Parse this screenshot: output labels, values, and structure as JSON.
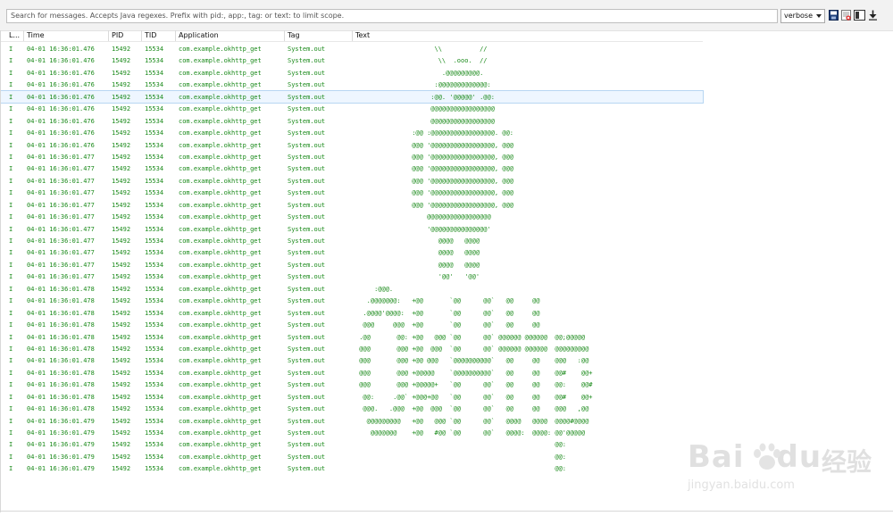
{
  "toolbar": {
    "search_placeholder": "Search for messages. Accepts Java regexes. Prefix with pid:, app:, tag: or text: to limit scope.",
    "level_value": "verbose"
  },
  "columns": {
    "level": "L...",
    "time": "Time",
    "pid": "PID",
    "tid": "TID",
    "application": "Application",
    "tag": "Tag",
    "text": "Text"
  },
  "rows": [
    {
      "l": "I",
      "time": "04-01 16:36:01.476",
      "pid": "15492",
      "tid": "15534",
      "app": "com.example.okhttp_get",
      "tag": "System.out",
      "text": "                     \\\\          //"
    },
    {
      "l": "I",
      "time": "04-01 16:36:01.476",
      "pid": "15492",
      "tid": "15534",
      "app": "com.example.okhttp_get",
      "tag": "System.out",
      "text": "                      \\\\  .ooo.  //"
    },
    {
      "l": "I",
      "time": "04-01 16:36:01.476",
      "pid": "15492",
      "tid": "15534",
      "app": "com.example.okhttp_get",
      "tag": "System.out",
      "text": "                       .@@@@@@@@@."
    },
    {
      "l": "I",
      "time": "04-01 16:36:01.476",
      "pid": "15492",
      "tid": "15534",
      "app": "com.example.okhttp_get",
      "tag": "System.out",
      "text": "                     :@@@@@@@@@@@@@:"
    },
    {
      "l": "I",
      "time": "04-01 16:36:01.476",
      "pid": "15492",
      "tid": "15534",
      "app": "com.example.okhttp_get",
      "tag": "System.out",
      "text": "                    :@@. '@@@@@' .@@:",
      "selected": true
    },
    {
      "l": "I",
      "time": "04-01 16:36:01.476",
      "pid": "15492",
      "tid": "15534",
      "app": "com.example.okhttp_get",
      "tag": "System.out",
      "text": "                    @@@@@@@@@@@@@@@@@"
    },
    {
      "l": "I",
      "time": "04-01 16:36:01.476",
      "pid": "15492",
      "tid": "15534",
      "app": "com.example.okhttp_get",
      "tag": "System.out",
      "text": "                    @@@@@@@@@@@@@@@@@"
    },
    {
      "l": "I",
      "time": "04-01 16:36:01.476",
      "pid": "15492",
      "tid": "15534",
      "app": "com.example.okhttp_get",
      "tag": "System.out",
      "text": "               :@@ :@@@@@@@@@@@@@@@@@. @@:"
    },
    {
      "l": "I",
      "time": "04-01 16:36:01.476",
      "pid": "15492",
      "tid": "15534",
      "app": "com.example.okhttp_get",
      "tag": "System.out",
      "text": "               @@@ '@@@@@@@@@@@@@@@@@, @@@"
    },
    {
      "l": "I",
      "time": "04-01 16:36:01.477",
      "pid": "15492",
      "tid": "15534",
      "app": "com.example.okhttp_get",
      "tag": "System.out",
      "text": "               @@@ '@@@@@@@@@@@@@@@@@, @@@"
    },
    {
      "l": "I",
      "time": "04-01 16:36:01.477",
      "pid": "15492",
      "tid": "15534",
      "app": "com.example.okhttp_get",
      "tag": "System.out",
      "text": "               @@@ '@@@@@@@@@@@@@@@@@, @@@"
    },
    {
      "l": "I",
      "time": "04-01 16:36:01.477",
      "pid": "15492",
      "tid": "15534",
      "app": "com.example.okhttp_get",
      "tag": "System.out",
      "text": "               @@@ '@@@@@@@@@@@@@@@@@, @@@"
    },
    {
      "l": "I",
      "time": "04-01 16:36:01.477",
      "pid": "15492",
      "tid": "15534",
      "app": "com.example.okhttp_get",
      "tag": "System.out",
      "text": "               @@@ '@@@@@@@@@@@@@@@@@, @@@"
    },
    {
      "l": "I",
      "time": "04-01 16:36:01.477",
      "pid": "15492",
      "tid": "15534",
      "app": "com.example.okhttp_get",
      "tag": "System.out",
      "text": "               @@@ '@@@@@@@@@@@@@@@@@, @@@"
    },
    {
      "l": "I",
      "time": "04-01 16:36:01.477",
      "pid": "15492",
      "tid": "15534",
      "app": "com.example.okhttp_get",
      "tag": "System.out",
      "text": "                   @@@@@@@@@@@@@@@@@"
    },
    {
      "l": "I",
      "time": "04-01 16:36:01.477",
      "pid": "15492",
      "tid": "15534",
      "app": "com.example.okhttp_get",
      "tag": "System.out",
      "text": "                   '@@@@@@@@@@@@@@@'"
    },
    {
      "l": "I",
      "time": "04-01 16:36:01.477",
      "pid": "15492",
      "tid": "15534",
      "app": "com.example.okhttp_get",
      "tag": "System.out",
      "text": "                      @@@@   @@@@"
    },
    {
      "l": "I",
      "time": "04-01 16:36:01.477",
      "pid": "15492",
      "tid": "15534",
      "app": "com.example.okhttp_get",
      "tag": "System.out",
      "text": "                      @@@@   @@@@"
    },
    {
      "l": "I",
      "time": "04-01 16:36:01.477",
      "pid": "15492",
      "tid": "15534",
      "app": "com.example.okhttp_get",
      "tag": "System.out",
      "text": "                      @@@@   @@@@"
    },
    {
      "l": "I",
      "time": "04-01 16:36:01.477",
      "pid": "15492",
      "tid": "15534",
      "app": "com.example.okhttp_get",
      "tag": "System.out",
      "text": "                      '@@'   '@@'"
    },
    {
      "l": "I",
      "time": "04-01 16:36:01.478",
      "pid": "15492",
      "tid": "15534",
      "app": "com.example.okhttp_get",
      "tag": "System.out",
      "text": "     :@@@."
    },
    {
      "l": "I",
      "time": "04-01 16:36:01.478",
      "pid": "15492",
      "tid": "15534",
      "app": "com.example.okhttp_get",
      "tag": "System.out",
      "text": "   .@@@@@@@:   +@@       `@@      @@`   @@     @@"
    },
    {
      "l": "I",
      "time": "04-01 16:36:01.478",
      "pid": "15492",
      "tid": "15534",
      "app": "com.example.okhttp_get",
      "tag": "System.out",
      "text": "  .@@@@'@@@@:  +@@       `@@      @@`   @@     @@"
    },
    {
      "l": "I",
      "time": "04-01 16:36:01.478",
      "pid": "15492",
      "tid": "15534",
      "app": "com.example.okhttp_get",
      "tag": "System.out",
      "text": "  @@@     @@@  +@@       `@@      @@`   @@     @@"
    },
    {
      "l": "I",
      "time": "04-01 16:36:01.478",
      "pid": "15492",
      "tid": "15534",
      "app": "com.example.okhttp_get",
      "tag": "System.out",
      "text": " .@@       @@: +@@   @@@ `@@      @@` @@@@@@ @@@@@@  @@;@@@@@"
    },
    {
      "l": "I",
      "time": "04-01 16:36:01.478",
      "pid": "15492",
      "tid": "15534",
      "app": "com.example.okhttp_get",
      "tag": "System.out",
      "text": " @@@       @@@ +@@  @@@  `@@      @@` @@@@@@ @@@@@@  @@@@@@@@@"
    },
    {
      "l": "I",
      "time": "04-01 16:36:01.478",
      "pid": "15492",
      "tid": "15534",
      "app": "com.example.okhttp_get",
      "tag": "System.out",
      "text": " @@@       @@@ +@@ @@@   `@@@@@@@@@@`   @@     @@    @@@   :@@"
    },
    {
      "l": "I",
      "time": "04-01 16:36:01.478",
      "pid": "15492",
      "tid": "15534",
      "app": "com.example.okhttp_get",
      "tag": "System.out",
      "text": " @@@       @@@ +@@@@@    `@@@@@@@@@@`   @@     @@    @@#    @@+"
    },
    {
      "l": "I",
      "time": "04-01 16:36:01.478",
      "pid": "15492",
      "tid": "15534",
      "app": "com.example.okhttp_get",
      "tag": "System.out",
      "text": " @@@       @@@ +@@@@@+   `@@      @@`   @@     @@    @@:    @@#"
    },
    {
      "l": "I",
      "time": "04-01 16:36:01.478",
      "pid": "15492",
      "tid": "15534",
      "app": "com.example.okhttp_get",
      "tag": "System.out",
      "text": "  @@:     .@@` +@@@+@@   `@@      @@`   @@     @@    @@#    @@+"
    },
    {
      "l": "I",
      "time": "04-01 16:36:01.478",
      "pid": "15492",
      "tid": "15534",
      "app": "com.example.okhttp_get",
      "tag": "System.out",
      "text": "  @@@.   .@@@  +@@  @@@  `@@      @@`   @@     @@    @@@   ,@@"
    },
    {
      "l": "I",
      "time": "04-01 16:36:01.479",
      "pid": "15492",
      "tid": "15534",
      "app": "com.example.okhttp_get",
      "tag": "System.out",
      "text": "   @@@@@@@@@   +@@   @@@ `@@      @@`   @@@@   @@@@  @@@@#@@@@"
    },
    {
      "l": "I",
      "time": "04-01 16:36:01.479",
      "pid": "15492",
      "tid": "15534",
      "app": "com.example.okhttp_get",
      "tag": "System.out",
      "text": "    @@@@@@@    +@@   #@@ `@@      @@`   @@@@:  @@@@: @@'@@@@@"
    },
    {
      "l": "I",
      "time": "04-01 16:36:01.479",
      "pid": "15492",
      "tid": "15534",
      "app": "com.example.okhttp_get",
      "tag": "System.out",
      "text": "                                                     @@:"
    },
    {
      "l": "I",
      "time": "04-01 16:36:01.479",
      "pid": "15492",
      "tid": "15534",
      "app": "com.example.okhttp_get",
      "tag": "System.out",
      "text": "                                                     @@:"
    },
    {
      "l": "I",
      "time": "04-01 16:36:01.479",
      "pid": "15492",
      "tid": "15534",
      "app": "com.example.okhttp_get",
      "tag": "System.out",
      "text": "                                                     @@:"
    }
  ],
  "watermark": {
    "brand": "Bai",
    "brand_tail": "du",
    "cn": "经验",
    "url": "jingyan.baidu.com"
  }
}
